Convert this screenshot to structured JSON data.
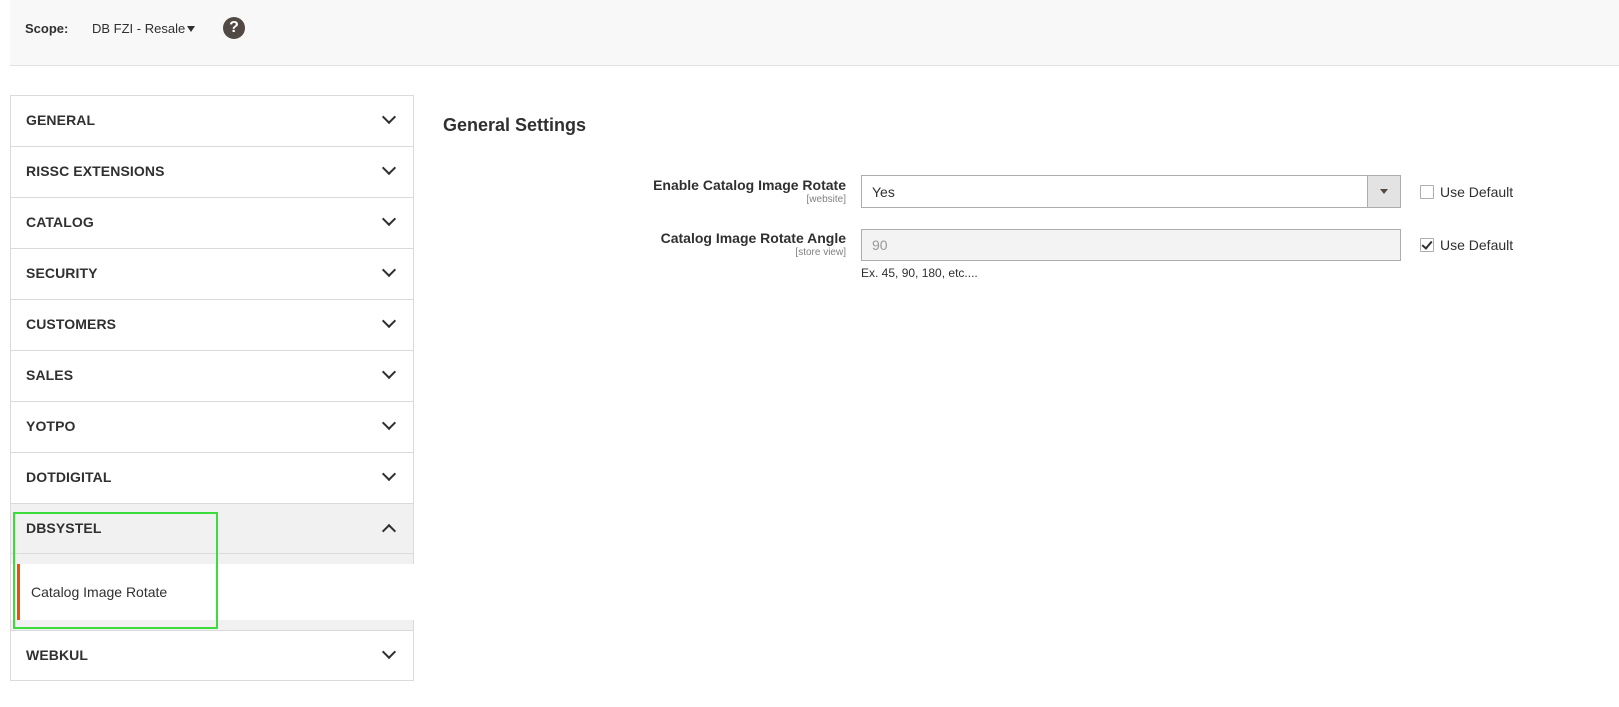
{
  "scope": {
    "label": "Scope:",
    "value": "DB FZI - Resale",
    "help_icon": "question-mark-icon"
  },
  "sidebar": {
    "sections": [
      {
        "label": "GENERAL",
        "expanded": false
      },
      {
        "label": "RISSC EXTENSIONS",
        "expanded": false
      },
      {
        "label": "CATALOG",
        "expanded": false
      },
      {
        "label": "SECURITY",
        "expanded": false
      },
      {
        "label": "CUSTOMERS",
        "expanded": false
      },
      {
        "label": "SALES",
        "expanded": false
      },
      {
        "label": "YOTPO",
        "expanded": false
      },
      {
        "label": "DOTDIGITAL",
        "expanded": false
      },
      {
        "label": "DBSYSTEL",
        "expanded": true,
        "items": [
          {
            "label": "Catalog Image Rotate",
            "active": true
          }
        ]
      },
      {
        "label": "WEBKUL",
        "expanded": false
      }
    ]
  },
  "main": {
    "title": "General Settings",
    "fields": [
      {
        "label": "Enable Catalog Image Rotate",
        "scope": "[website]",
        "value": "Yes",
        "use_default_label": "Use Default",
        "use_default": false
      },
      {
        "label": "Catalog Image Rotate Angle",
        "scope": "[store view]",
        "value": "90",
        "hint": "Ex. 45, 90, 180, etc....",
        "use_default_label": "Use Default",
        "use_default": true
      }
    ]
  },
  "colors": {
    "active_accent": "#eb5202",
    "highlight": "#3ddc3d"
  }
}
